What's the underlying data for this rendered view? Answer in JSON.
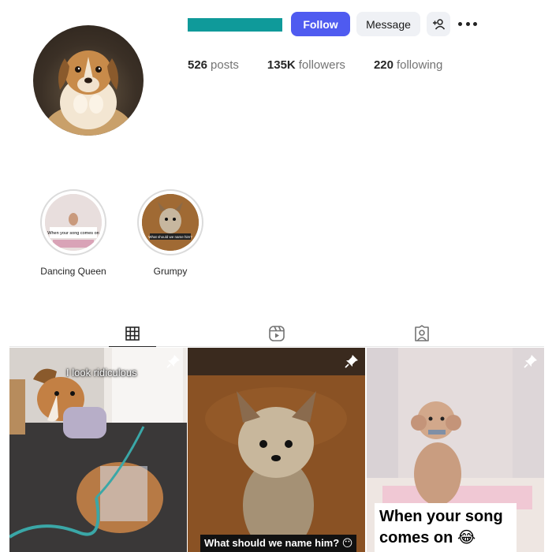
{
  "profile": {
    "username_bar_color": "#0f9a9a",
    "avatar_alt": "Puppy with paws together"
  },
  "actions": {
    "follow_label": "Follow",
    "message_label": "Message",
    "add_user_icon": "person-plus-icon",
    "more_icon": "more-options-icon"
  },
  "stats": [
    {
      "count": "526",
      "label": "posts"
    },
    {
      "count": "135K",
      "label": "followers"
    },
    {
      "count": "220",
      "label": "following"
    }
  ],
  "highlights": [
    {
      "label": "Dancing Queen",
      "thumb_text": "When your song comes on"
    },
    {
      "label": "Grumpy",
      "thumb_text": "What should we name him?"
    }
  ],
  "tabs": [
    {
      "name": "posts",
      "icon": "grid-icon",
      "active": true
    },
    {
      "name": "reels",
      "icon": "reels-icon",
      "active": false
    },
    {
      "name": "tagged",
      "icon": "tagged-icon",
      "active": false
    }
  ],
  "posts": [
    {
      "caption": "I look ridiculous",
      "pinned": true
    },
    {
      "caption": "What should we name him? 😶",
      "pinned": true
    },
    {
      "caption_line1": "When your song",
      "caption_line2": "comes on 😂",
      "pinned": true
    }
  ],
  "colors": {
    "follow_button": "#4f5bf0",
    "secondary_button": "#eff1f5"
  }
}
